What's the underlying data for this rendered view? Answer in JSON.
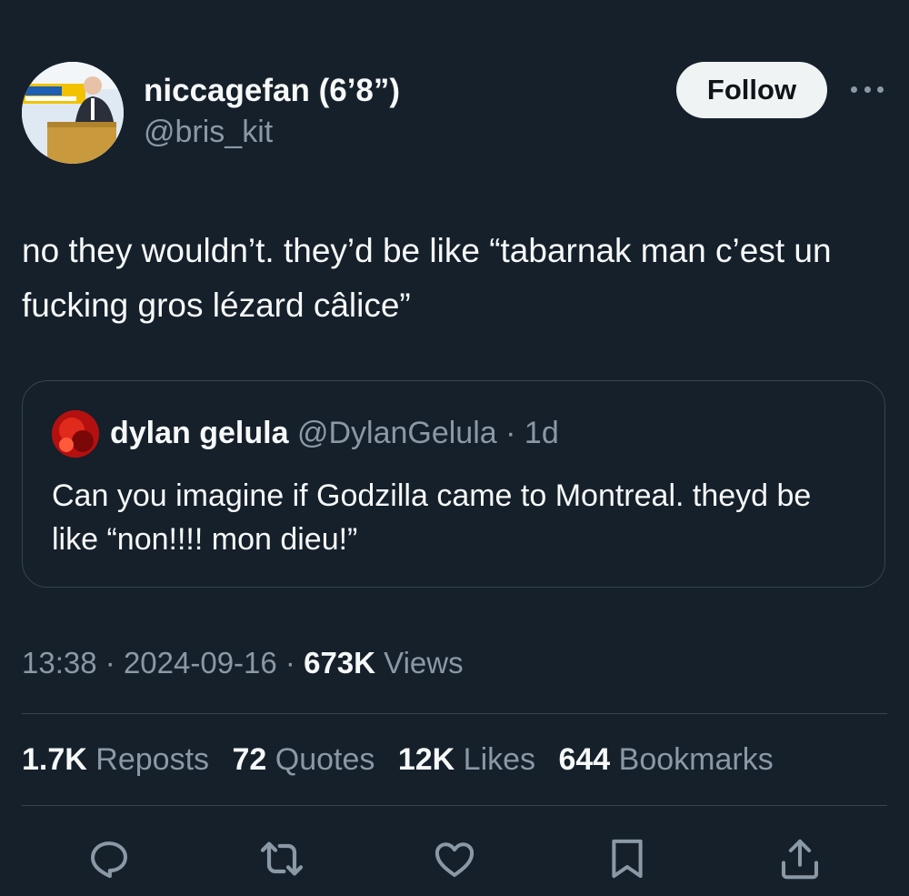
{
  "author": {
    "display_name": "niccagefan (6’8”)",
    "handle": "@bris_kit",
    "avatar": "podium-speaker-photo"
  },
  "follow_button": {
    "label": "Follow"
  },
  "more_button": {
    "icon": "more-horizontal-icon"
  },
  "tweet": {
    "text": "no they wouldn’t. they’d be like “tabarnak man c’est un fucking gros lézard câlice”"
  },
  "quoted_tweet": {
    "display_name": "dylan gelula",
    "handle": "@DylanGelula",
    "separator": "·",
    "age": "1d",
    "text": "Can you imagine if Godzilla came to Montreal. theyd be like “non!!!! mon dieu!”",
    "avatar": "red-photo-avatar"
  },
  "meta": {
    "time": "13:38",
    "date": "2024-09-16",
    "views_count": "673K",
    "views_label": "Views",
    "separator": "·"
  },
  "stats": [
    {
      "count": "1.7K",
      "label": "Reposts"
    },
    {
      "count": "72",
      "label": "Quotes"
    },
    {
      "count": "12K",
      "label": "Likes"
    },
    {
      "count": "644",
      "label": "Bookmarks"
    }
  ],
  "actions": [
    "reply-icon",
    "repost-icon",
    "like-icon",
    "bookmark-icon",
    "share-icon"
  ],
  "colors": {
    "background": "#15202b",
    "text": "#f7f9f9",
    "secondary_text": "#8b98a5",
    "border": "#38444d",
    "follow_button_bg": "#eff3f4"
  }
}
